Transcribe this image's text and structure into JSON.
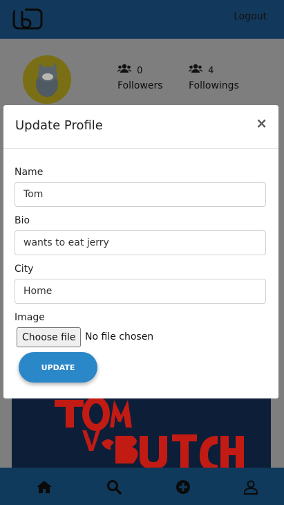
{
  "header": {
    "logo_icon": "logo-icon",
    "logout_label": "Logout"
  },
  "profile": {
    "followers": {
      "count": "0",
      "label": "Followers",
      "icon": "users-icon"
    },
    "followings": {
      "count": "4",
      "label": "Followings",
      "icon": "users-icon"
    }
  },
  "modal": {
    "title": "Update Profile",
    "close_symbol": "×",
    "fields": {
      "name": {
        "label": "Name",
        "value": "Tom"
      },
      "bio": {
        "label": "Bio",
        "value": "wants to eat jerry"
      },
      "city": {
        "label": "City",
        "value": "Home"
      }
    },
    "image": {
      "label": "Image",
      "button_label": "Choose file",
      "status": "No file chosen"
    },
    "submit_label": "UPDATE"
  },
  "bottom_nav": {
    "items": [
      {
        "icon": "home-icon"
      },
      {
        "icon": "search-icon"
      },
      {
        "icon": "add-icon"
      },
      {
        "icon": "user-icon"
      }
    ]
  },
  "colors": {
    "topbar": "#12395b",
    "accent": "#2a87c8",
    "overlay": "#7e7e7e"
  }
}
